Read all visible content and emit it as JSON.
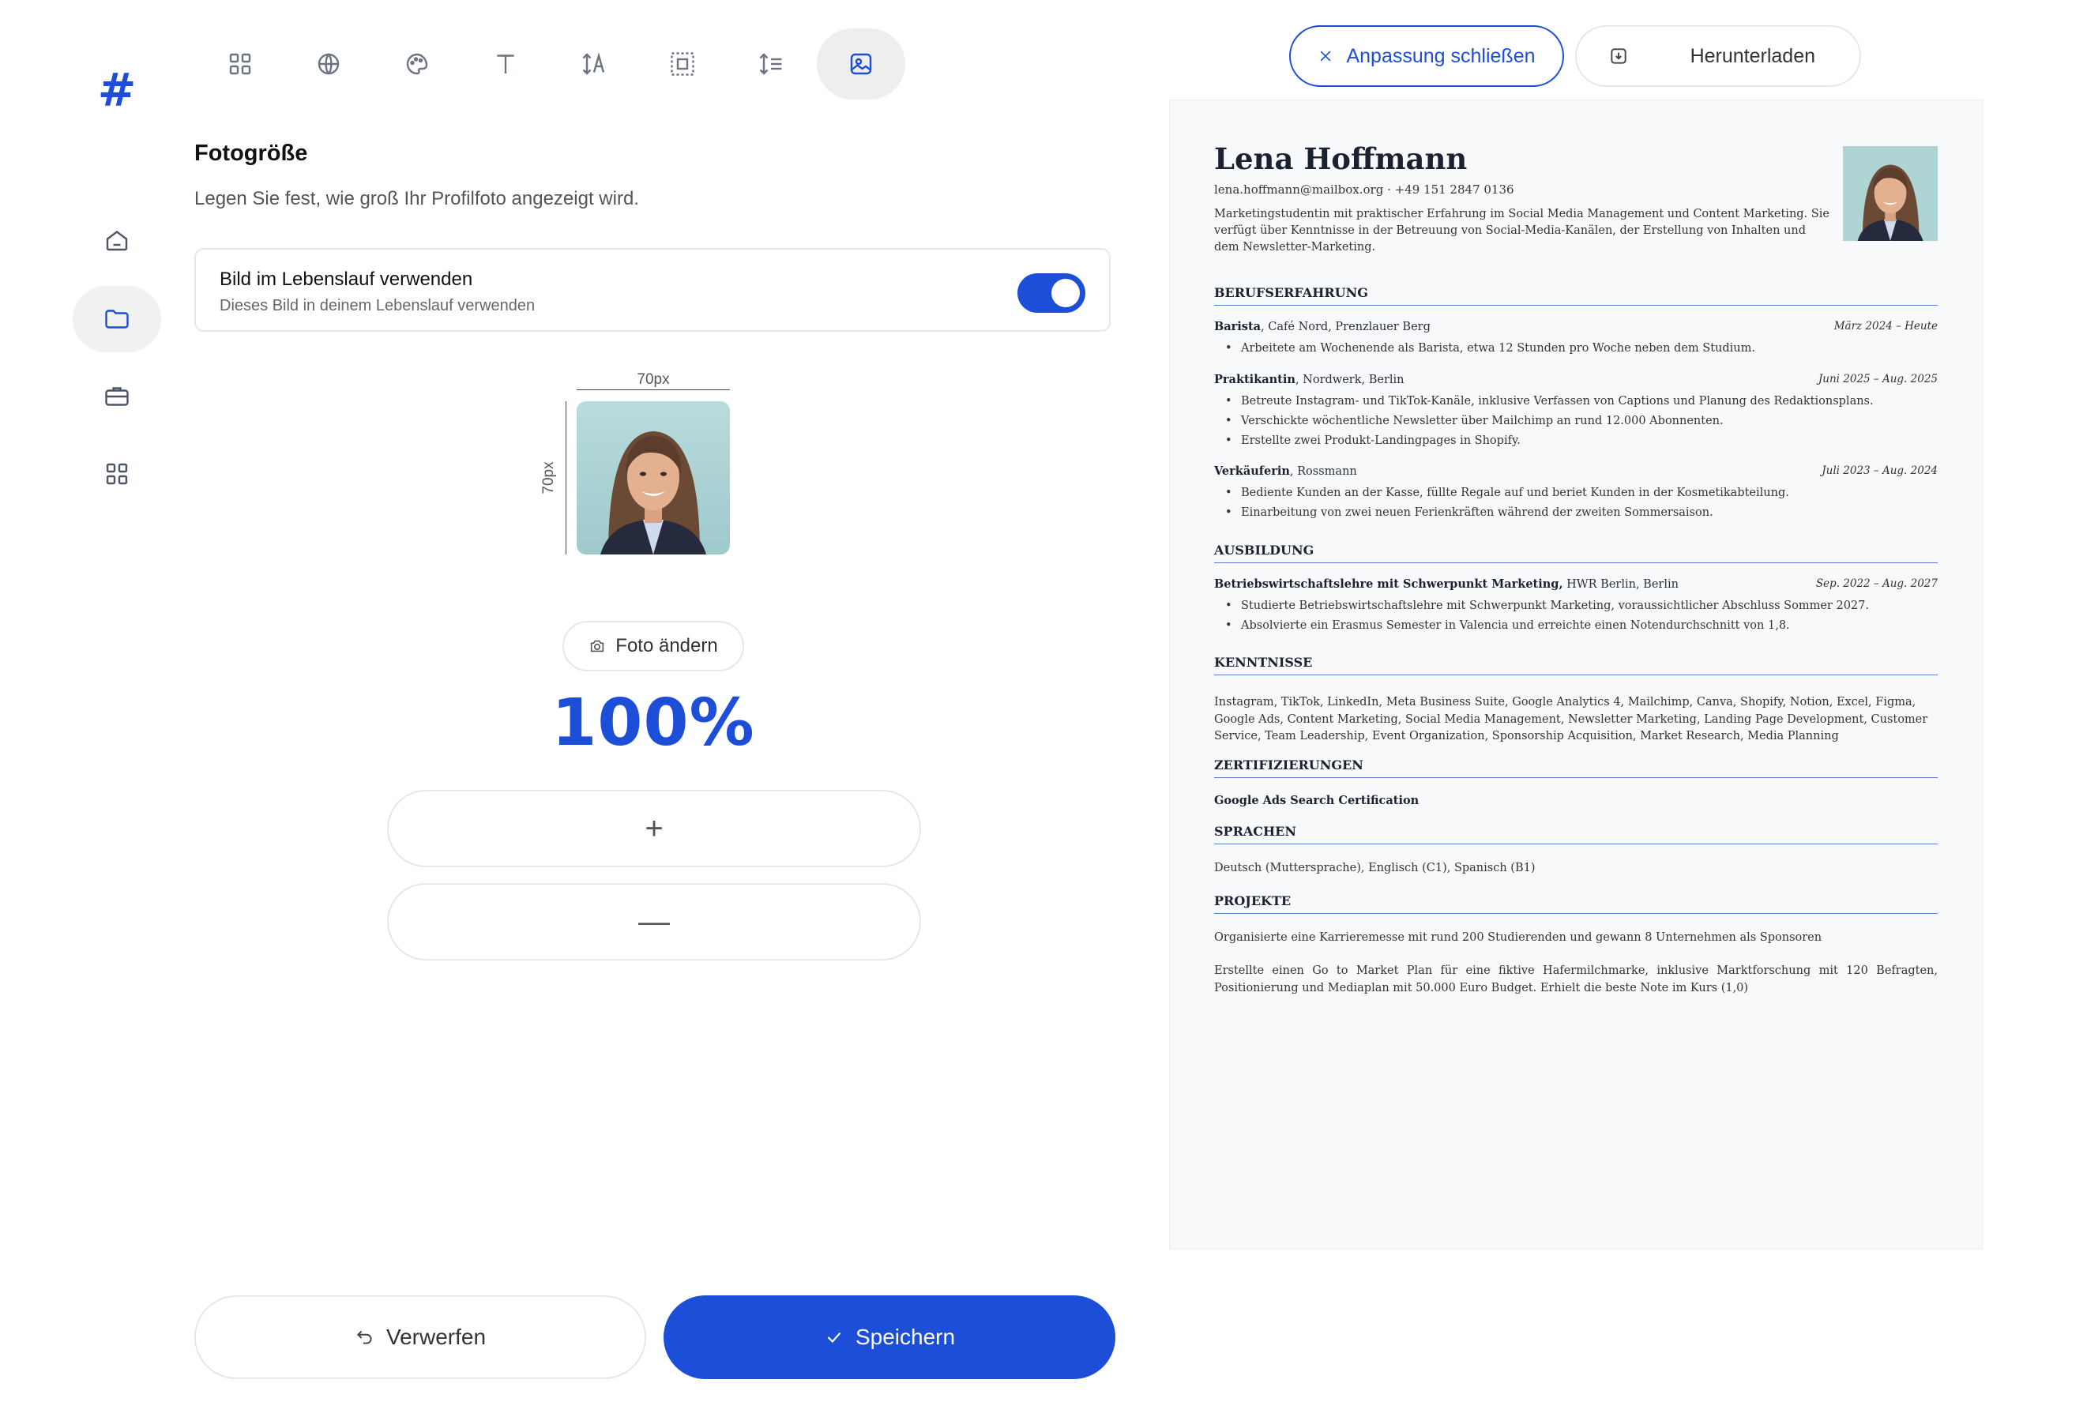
{
  "app": {
    "logo_glyph": "#",
    "accent_color": "#1d4ed8"
  },
  "sidebar": {
    "items": [
      {
        "name": "home",
        "icon": "home-icon"
      },
      {
        "name": "folder",
        "icon": "folder-icon",
        "active": true
      },
      {
        "name": "briefcase",
        "icon": "briefcase-icon"
      },
      {
        "name": "apps",
        "icon": "grid-icon"
      }
    ]
  },
  "toolbar": {
    "tools": [
      {
        "name": "layout",
        "icon": "grid-icon"
      },
      {
        "name": "language",
        "icon": "globe-icon"
      },
      {
        "name": "colors",
        "icon": "palette-icon"
      },
      {
        "name": "font",
        "icon": "text-icon"
      },
      {
        "name": "font-size",
        "icon": "font-size-icon"
      },
      {
        "name": "spacing",
        "icon": "margin-icon"
      },
      {
        "name": "line-height",
        "icon": "line-height-icon"
      },
      {
        "name": "photo",
        "icon": "image-icon",
        "active": true
      }
    ]
  },
  "panel": {
    "title": "Fotogröße",
    "subtitle": "Legen Sie fest, wie groß Ihr Profilfoto angezeigt wird.",
    "toggle": {
      "title": "Bild im Lebenslauf verwenden",
      "subtitle": "Dieses Bild in deinem Lebenslauf verwenden",
      "enabled": true
    },
    "dimension_width_label": "70px",
    "dimension_height_label": "70px",
    "change_photo_label": "Foto ändern",
    "size_percent": "100%",
    "increase_symbol": "+",
    "decrease_symbol": "—"
  },
  "footer": {
    "discard_label": "Verwerfen",
    "save_label": "Speichern"
  },
  "topbar": {
    "close_label": "Anpassung schließen",
    "download_label": "Herunterladen"
  },
  "resume": {
    "name": "Lena Hoffmann",
    "contact": "lena.hoffmann@mailbox.org · +49 151 2847 0136",
    "summary": "Marketingstudentin mit praktischer Erfahrung im Social Media Management und Content Marketing. Sie verfügt über Kenntnisse in der Betreuung von Social-Media-Kanälen, der Erstellung von Inhalten und dem Newsletter-Marketing.",
    "sections": {
      "experience": "BERUFSERFAHRUNG",
      "education": "AUSBILDUNG",
      "skills": "KENNTNISSE",
      "certifications": "ZERTIFIZIERUNGEN",
      "languages": "SPRACHEN",
      "projects": "PROJEKTE"
    },
    "experience": [
      {
        "role": "Barista",
        "company": ", Café Nord, Prenzlauer Berg",
        "date": "März 2024 – Heute",
        "bullets": [
          "Arbeitete am Wochenende als Barista, etwa 12 Stunden pro Woche neben dem Studium."
        ]
      },
      {
        "role": "Praktikantin",
        "company": ", Nordwerk, Berlin",
        "date": "Juni 2025 – Aug. 2025",
        "bullets": [
          "Betreute Instagram- und TikTok-Kanäle, inklusive Verfassen von Captions und Planung des Redaktionsplans.",
          "Verschickte wöchentliche Newsletter über Mailchimp an rund 12.000 Abonnenten.",
          "Erstellte zwei Produkt-Landingpages in Shopify."
        ]
      },
      {
        "role": "Verkäuferin",
        "company": ", Rossmann",
        "date": "Juli 2023 – Aug. 2024",
        "bullets": [
          "Bediente Kunden an der Kasse, füllte Regale auf und beriet Kunden in der Kosmetikabteilung.",
          "Einarbeitung von zwei neuen Ferienkräften während der zweiten Sommersaison."
        ]
      }
    ],
    "education": {
      "degree": "Betriebswirtschaftslehre mit Schwerpunkt Marketing,",
      "school": " HWR Berlin, Berlin",
      "date": "Sep. 2022 – Aug. 2027",
      "bullets": [
        "Studierte Betriebswirtschaftslehre mit Schwerpunkt Marketing, voraussichtlicher Abschluss Sommer 2027.",
        "Absolvierte ein Erasmus Semester in Valencia und erreichte einen Notendurchschnitt von 1,8."
      ]
    },
    "skills": "Instagram, TikTok, LinkedIn, Meta Business Suite, Google Analytics 4, Mailchimp, Canva, Shopify, Notion, Excel, Figma, Google Ads, Content Marketing, Social Media Management, Newsletter Marketing, Landing Page Development, Customer Service, Team Leadership, Event Organization, Sponsorship Acquisition, Market Research, Media Planning",
    "certification": "Google Ads Search Certification",
    "languages": "Deutsch (Muttersprache), Englisch (C1), Spanisch (B1)",
    "projects": [
      "Organisierte eine Karrieremesse mit rund 200 Studierenden und gewann 8 Unternehmen als Sponsoren",
      "Erstellte einen Go to Market Plan für eine fiktive Hafermilchmarke, inklusive Marktforschung mit 120 Befragten, Positionierung und Mediaplan mit 50.000 Euro Budget. Erhielt die beste Note im Kurs (1,0)"
    ]
  }
}
